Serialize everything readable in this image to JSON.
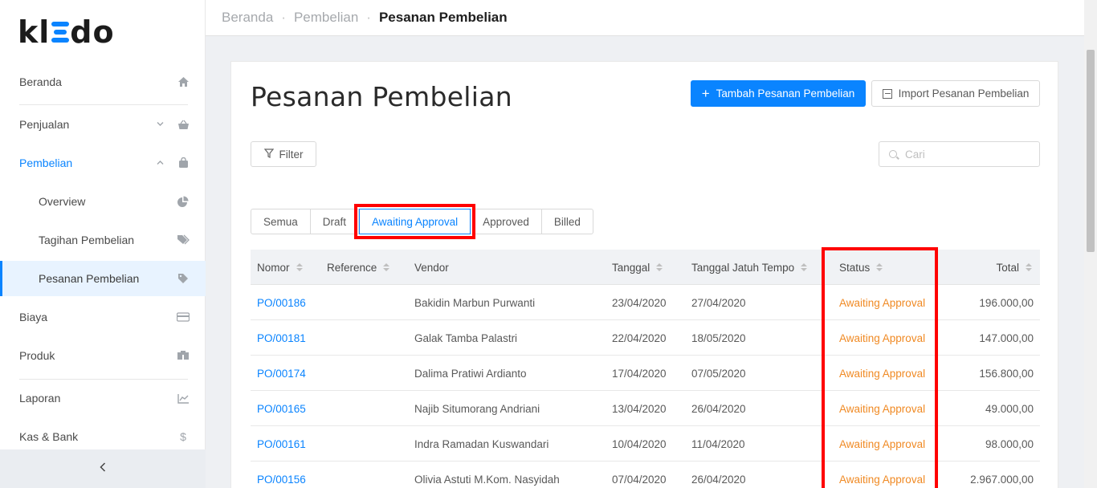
{
  "brand": {
    "logo_left": "kl",
    "logo_right": "do",
    "accent": "#0a84ff"
  },
  "sidebar": {
    "items": [
      {
        "label": "Beranda",
        "icon": "home-icon"
      },
      {
        "label": "Penjualan",
        "icon": "basket-icon"
      },
      {
        "label": "Pembelian",
        "icon": "bag-icon"
      },
      {
        "label": "Overview",
        "icon": "pie-chart-icon"
      },
      {
        "label": "Tagihan Pembelian",
        "icon": "tags-icon"
      },
      {
        "label": "Pesanan Pembelian",
        "icon": "tag-icon"
      },
      {
        "label": "Biaya",
        "icon": "credit-card-icon"
      },
      {
        "label": "Produk",
        "icon": "boxes-icon"
      },
      {
        "label": "Laporan",
        "icon": "line-chart-icon"
      },
      {
        "label": "Kas & Bank",
        "icon": "dollar-icon"
      }
    ],
    "collapse_glyph": "<"
  },
  "breadcrumb": {
    "items": [
      "Beranda",
      "Pembelian"
    ],
    "current": "Pesanan Pembelian",
    "separator": "·"
  },
  "page": {
    "title": "Pesanan Pembelian",
    "add_button": "Tambah Pesanan Pembelian",
    "import_button": "Import Pesanan Pembelian",
    "filter_button": "Filter",
    "search_placeholder": "Cari"
  },
  "tabs": [
    {
      "label": "Semua"
    },
    {
      "label": "Draft"
    },
    {
      "label": "Awaiting Approval"
    },
    {
      "label": "Approved"
    },
    {
      "label": "Billed"
    }
  ],
  "active_tab": "Awaiting Approval",
  "table": {
    "columns": [
      "Nomor",
      "Reference",
      "Vendor",
      "Tanggal",
      "Tanggal Jatuh Tempo",
      "Status",
      "Total"
    ],
    "rows": [
      {
        "nomor": "PO/00186",
        "reference": "",
        "vendor": "Bakidin Marbun Purwanti",
        "tanggal": "23/04/2020",
        "jatuh_tempo": "27/04/2020",
        "status": "Awaiting Approval",
        "total": "196.000,00"
      },
      {
        "nomor": "PO/00181",
        "reference": "",
        "vendor": "Galak Tamba Palastri",
        "tanggal": "22/04/2020",
        "jatuh_tempo": "18/05/2020",
        "status": "Awaiting Approval",
        "total": "147.000,00"
      },
      {
        "nomor": "PO/00174",
        "reference": "",
        "vendor": "Dalima Pratiwi Ardianto",
        "tanggal": "17/04/2020",
        "jatuh_tempo": "07/05/2020",
        "status": "Awaiting Approval",
        "total": "156.800,00"
      },
      {
        "nomor": "PO/00165",
        "reference": "",
        "vendor": "Najib Situmorang Andriani",
        "tanggal": "13/04/2020",
        "jatuh_tempo": "26/04/2020",
        "status": "Awaiting Approval",
        "total": "49.000,00"
      },
      {
        "nomor": "PO/00161",
        "reference": "",
        "vendor": "Indra Ramadan Kuswandari",
        "tanggal": "10/04/2020",
        "jatuh_tempo": "11/04/2020",
        "status": "Awaiting Approval",
        "total": "98.000,00"
      },
      {
        "nomor": "PO/00156",
        "reference": "",
        "vendor": "Olivia Astuti M.Kom. Nasyidah",
        "tanggal": "07/04/2020",
        "jatuh_tempo": "26/04/2020",
        "status": "Awaiting Approval",
        "total": "2.967.000,00"
      }
    ]
  },
  "colors": {
    "link": "#0a84ff",
    "status_awaiting": "#f08a24",
    "highlight": "#ff0000"
  }
}
